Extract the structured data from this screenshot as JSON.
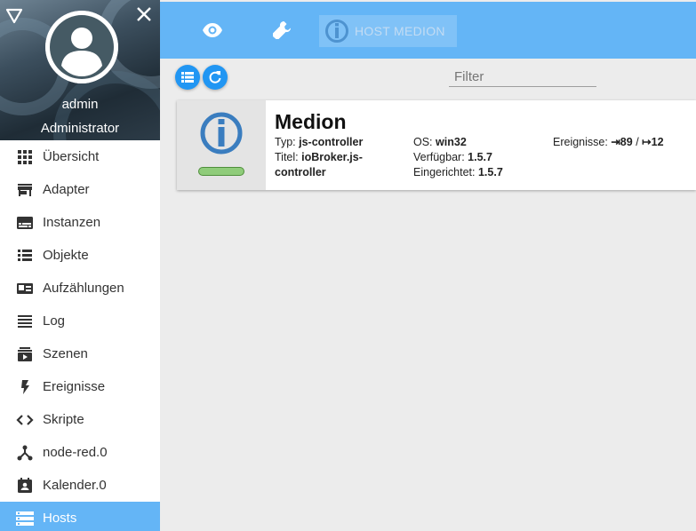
{
  "user": {
    "name": "admin",
    "role": "Administrator"
  },
  "nav": [
    {
      "label": "Übersicht",
      "icon": "grid-icon"
    },
    {
      "label": "Adapter",
      "icon": "store-icon"
    },
    {
      "label": "Instanzen",
      "icon": "subtitles-icon"
    },
    {
      "label": "Objekte",
      "icon": "list-icon"
    },
    {
      "label": "Aufzählungen",
      "icon": "featured-play-list-icon"
    },
    {
      "label": "Log",
      "icon": "reorder-icon"
    },
    {
      "label": "Szenen",
      "icon": "subscriptions-icon"
    },
    {
      "label": "Ereignisse",
      "icon": "flash-icon"
    },
    {
      "label": "Skripte",
      "icon": "code-icon"
    },
    {
      "label": "node-red.0",
      "icon": "node-red-icon"
    },
    {
      "label": "Kalender.0",
      "icon": "calendar-account-icon"
    },
    {
      "label": "Hosts",
      "icon": "storage-icon",
      "active": true
    }
  ],
  "topbar": {
    "host_tab_label": "HOST MEDION"
  },
  "toolbar": {
    "filter_placeholder": "Filter"
  },
  "host": {
    "name": "Medion",
    "type_label": "Typ:",
    "type_value": "js-controller",
    "title_label": "Titel:",
    "title_value_1": "ioBroker.js-",
    "title_value_2": "controller",
    "os_label": "OS:",
    "os_value": "win32",
    "available_label": "Verfügbar:",
    "available_value": "1.5.7",
    "installed_label": "Eingerichtet:",
    "installed_value": "1.5.7",
    "events_label": "Ereignisse:",
    "events_in": "⇥89",
    "events_sep": "/",
    "events_out": "↦12",
    "status": "alive"
  },
  "colors": {
    "primary": "#64b5f6",
    "accent": "#2196f3",
    "status_ok": "#8fcc7a",
    "logo": "#3a7dbf"
  }
}
